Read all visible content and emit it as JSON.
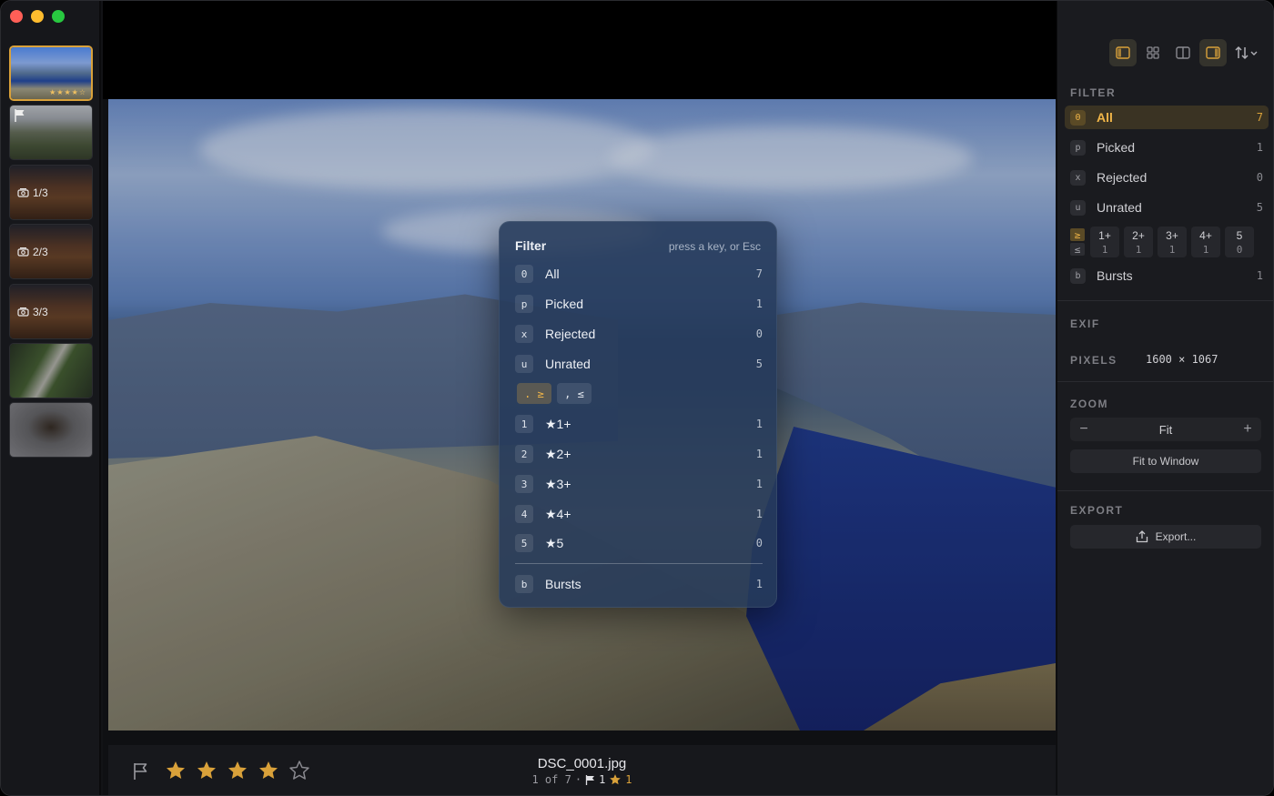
{
  "colors": {
    "accent": "#d9a13a",
    "popup_bg": "#263a5a",
    "sidebar_bg": "#1a1b1f",
    "filmstrip_bg": "#16171b"
  },
  "filmstrip": {
    "thumbs": [
      {
        "kind": "selected",
        "stars": "★★★★☆"
      },
      {
        "kind": "flagged",
        "icon": "flag-icon"
      },
      {
        "kind": "burst",
        "label": "1/3",
        "icon": "burst-stack-icon"
      },
      {
        "kind": "burst",
        "label": "2/3",
        "icon": "burst-stack-icon"
      },
      {
        "kind": "burst",
        "label": "3/3",
        "icon": "burst-stack-icon"
      },
      {
        "kind": "plain"
      },
      {
        "kind": "plain"
      }
    ]
  },
  "toolbar": {
    "buttons": [
      {
        "icon": "sidebar-left-icon",
        "active": true
      },
      {
        "icon": "grid-icon",
        "active": false
      },
      {
        "icon": "split-view-icon",
        "active": false
      },
      {
        "icon": "sidebar-right-icon",
        "active": true
      },
      {
        "icon": "sort-icon",
        "active": false
      }
    ]
  },
  "bottom": {
    "filename": "DSC_0001.jpg",
    "position": "1 of 7",
    "dot": "·",
    "flag_count": "1",
    "star_count": "1",
    "rating": 4,
    "max_rating": 5
  },
  "popup": {
    "title": "Filter",
    "hint": "press a key, or Esc",
    "rows": [
      {
        "key": "0",
        "label": "All",
        "count": "7"
      },
      {
        "key": "p",
        "label": "Picked",
        "count": "1"
      },
      {
        "key": "x",
        "label": "Rejected",
        "count": "0"
      },
      {
        "key": "u",
        "label": "Unrated",
        "count": "5"
      }
    ],
    "ge_label": ". ≥",
    "le_label": ", ≤",
    "rating_rows": [
      {
        "key": "1",
        "label": "★1+",
        "count": "1"
      },
      {
        "key": "2",
        "label": "★2+",
        "count": "1"
      },
      {
        "key": "3",
        "label": "★3+",
        "count": "1"
      },
      {
        "key": "4",
        "label": "★4+",
        "count": "1"
      },
      {
        "key": "5",
        "label": "★5",
        "count": "0"
      }
    ],
    "bursts": {
      "key": "b",
      "label": "Bursts",
      "count": "1"
    }
  },
  "sidebar": {
    "filter_title": "FILTER",
    "filters": [
      {
        "key": "0",
        "label": "All",
        "count": "7",
        "active": true
      },
      {
        "key": "p",
        "label": "Picked",
        "count": "1",
        "active": false
      },
      {
        "key": "x",
        "label": "Rejected",
        "count": "0",
        "active": false
      },
      {
        "key": "u",
        "label": "Unrated",
        "count": "5",
        "active": false
      }
    ],
    "ge": "≥",
    "le": "≤",
    "ratings": [
      {
        "label": "1+",
        "count": "1"
      },
      {
        "label": "2+",
        "count": "1"
      },
      {
        "label": "3+",
        "count": "1"
      },
      {
        "label": "4+",
        "count": "1"
      },
      {
        "label": "5",
        "count": "0"
      }
    ],
    "bursts": {
      "key": "b",
      "label": "Bursts",
      "count": "1"
    },
    "exif_title": "EXIF",
    "pixels_label": "PIXELS",
    "pixels_value": "1600 × 1067",
    "zoom_title": "ZOOM",
    "zoom_minus": "−",
    "zoom_value": "Fit",
    "zoom_plus": "+",
    "fit_to_window": "Fit to Window",
    "export_title": "EXPORT",
    "export_button": "Export..."
  }
}
